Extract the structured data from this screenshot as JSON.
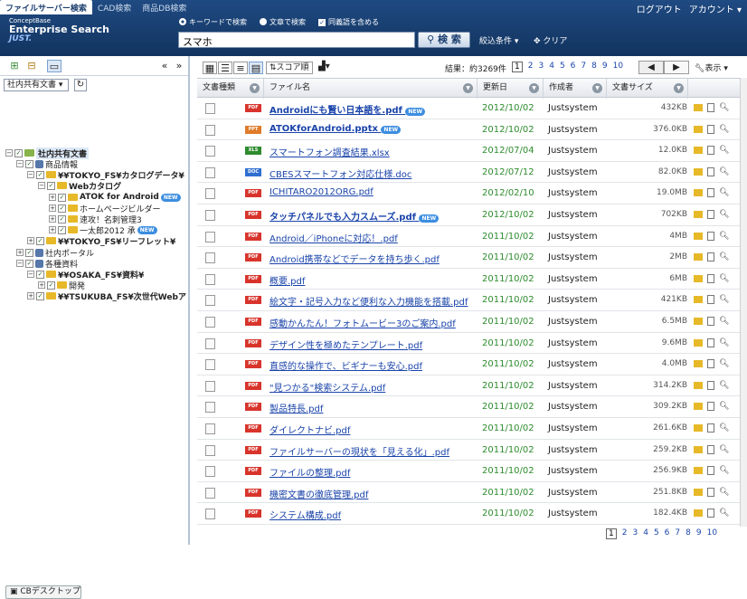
{
  "header": {
    "tabs": [
      "ファイルサーバー検索",
      "CAD検索",
      "商品DB検索"
    ],
    "logo": [
      "ConceptBase",
      "Enterprise Search",
      "JUST."
    ],
    "opt_keyword": "キーワードで検索",
    "opt_text": "文章で検索",
    "opt_synonym": "同義語を含める",
    "query": "スマホ",
    "search_label": "検 索",
    "narrow": "絞込条件",
    "clear": "クリア",
    "logout": "ログアウト",
    "account": "アカウント"
  },
  "left": {
    "selector": "社内共有文書",
    "desktop": "CBデスクトップ",
    "tree": [
      "社内共有文書",
      "商品情報",
      "¥¥TOKYO_FS¥カタログデータ¥",
      "Webカタログ",
      "ATOK for Android",
      "ホームページビルダー",
      "速攻！名刺管理3",
      "一太郎2012 承",
      "¥¥TOKYO_FS¥リーフレット¥",
      "社内ポータル",
      "各種資料",
      "¥¥OSAKA_FS¥資料¥",
      "開発",
      "¥¥TSUKUBA_FS¥次世代Webア"
    ],
    "new_badge": "NEW"
  },
  "results": {
    "score_label": "スコア順",
    "count": "結果：約3269件",
    "view": "表示",
    "pages": [
      "1",
      "2",
      "3",
      "4",
      "5",
      "6",
      "7",
      "8",
      "9",
      "10"
    ],
    "columns": [
      "文書種類",
      "ファイル名",
      "更新日",
      "作成者",
      "文書サイズ"
    ],
    "rows": [
      {
        "type": "PDF",
        "name": "Androidにも賢い日本語を.pdf",
        "date": "2012/10/02",
        "author": "Justsystem",
        "size": "432KB"
      },
      {
        "type": "PPT",
        "name": "ATOKforAndroid.pptx",
        "date": "2012/10/02",
        "author": "Justsystem",
        "size": "376.0KB"
      },
      {
        "type": "XLS",
        "name": "スマートフォン調査結果.xlsx",
        "date": "2012/07/04",
        "author": "Justsystem",
        "size": "12.0KB"
      },
      {
        "type": "DOC",
        "name": "CBESスマートフォン対応仕様.doc",
        "date": "2012/07/12",
        "author": "Justsystem",
        "size": "82.0KB"
      },
      {
        "type": "PDF",
        "name": "ICHITARO2012ORG.pdf",
        "date": "2012/02/10",
        "author": "Justsystem",
        "size": "19.0MB"
      },
      {
        "type": "PDF",
        "name": "タッチパネルでも入力スムーズ.pdf",
        "date": "2012/10/02",
        "author": "Justsystem",
        "size": "702KB"
      },
      {
        "type": "PDF",
        "name": "Android／iPhoneに対応！.pdf",
        "date": "2011/10/02",
        "author": "Justsystem",
        "size": "4MB"
      },
      {
        "type": "PDF",
        "name": "Android携帯などでデータを持ち歩く.pdf",
        "date": "2011/10/02",
        "author": "Justsystem",
        "size": "2MB"
      },
      {
        "type": "PDF",
        "name": "概要.pdf",
        "date": "2011/10/02",
        "author": "Justsystem",
        "size": "6MB"
      },
      {
        "type": "PDF",
        "name": "絵文字・記号入力など便利な入力機能を搭載.pdf",
        "date": "2011/10/02",
        "author": "Justsystem",
        "size": "421KB"
      },
      {
        "type": "PDF",
        "name": "感動かんたん！フォトムービー3のご案内.pdf",
        "date": "2011/10/02",
        "author": "Justsystem",
        "size": "6.5MB"
      },
      {
        "type": "PDF",
        "name": "デザイン性を極めたテンプレート.pdf",
        "date": "2011/10/02",
        "author": "Justsystem",
        "size": "9.6MB"
      },
      {
        "type": "PDF",
        "name": "直感的な操作で、ビギナーも安心.pdf",
        "date": "2011/10/02",
        "author": "Justsystem",
        "size": "4.0MB"
      },
      {
        "type": "PDF",
        "name": "\"見つかる\"検索システム.pdf",
        "date": "2011/10/02",
        "author": "Justsystem",
        "size": "314.2KB"
      },
      {
        "type": "PDF",
        "name": "製品特長.pdf",
        "date": "2011/10/02",
        "author": "Justsystem",
        "size": "309.2KB"
      },
      {
        "type": "PDF",
        "name": "ダイレクトナビ.pdf",
        "date": "2011/10/02",
        "author": "Justsystem",
        "size": "261.6KB"
      },
      {
        "type": "PDF",
        "name": "ファイルサーバーの現状を「見える化」.pdf",
        "date": "2011/10/02",
        "author": "Justsystem",
        "size": "259.2KB"
      },
      {
        "type": "PDF",
        "name": "ファイルの整理.pdf",
        "date": "2011/10/02",
        "author": "Justsystem",
        "size": "256.9KB"
      },
      {
        "type": "PDF",
        "name": "機密文書の徹底管理.pdf",
        "date": "2011/10/02",
        "author": "Justsystem",
        "size": "251.8KB"
      },
      {
        "type": "PDF",
        "name": "システム構成.pdf",
        "date": "2011/10/02",
        "author": "Justsystem",
        "size": "182.4KB"
      }
    ]
  },
  "colors": {
    "header": "#1a3d6e",
    "pdf": "#d8342c",
    "ppt": "#e07b2a",
    "xls": "#2e8b2e",
    "doc": "#2f6fd0",
    "date": "#2e8b2e",
    "link": "#1a44aa"
  }
}
